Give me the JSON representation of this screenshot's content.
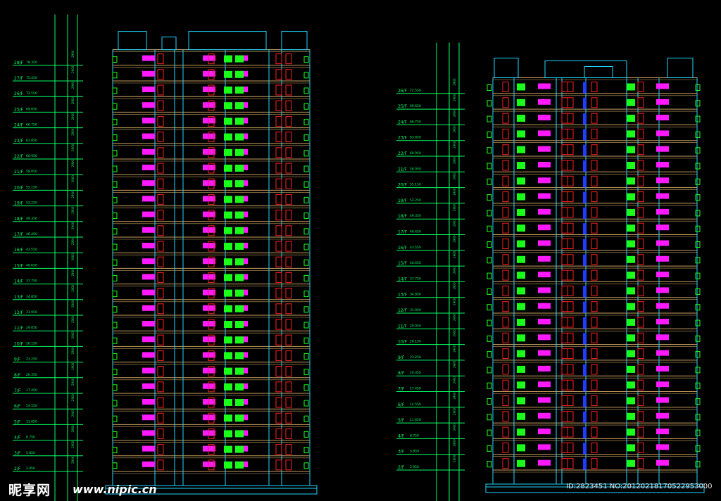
{
  "watermark": {
    "logo": "昵享网",
    "site": "www.nipic.cn",
    "id_line": "ID:2823451 NO:20120218170522953000"
  },
  "colors": {
    "background": "#000000",
    "dimension_line": "#00ff66",
    "outline": "#1fd6ff",
    "floor_band": "#c8a060",
    "window_red": "#ff2020",
    "balcony_magenta": "#ff19ff",
    "balcony_green": "#19ff19",
    "stair_blue": "#1f3cff"
  },
  "elevations": [
    {
      "name": "left",
      "floor_labels": [
        "2/F",
        "3/F",
        "4/F",
        "5/F",
        "6/F",
        "7/F",
        "8/F",
        "9/F",
        "10/F",
        "11/F",
        "12/F",
        "13/F",
        "14/F",
        "15/F",
        "16/F",
        "17/F",
        "18/F",
        "19/F",
        "20/F",
        "21/F",
        "22/F",
        "23/F",
        "24/F",
        "25/F",
        "26/F",
        "27/F",
        "28/F"
      ],
      "level_values": [
        "2.950",
        "5.850",
        "8.750",
        "11.650",
        "14.550",
        "17.450",
        "20.350",
        "23.250",
        "26.150",
        "29.050",
        "31.950",
        "34.850",
        "37.750",
        "40.650",
        "43.550",
        "46.450",
        "49.350",
        "52.250",
        "55.150",
        "58.050",
        "60.950",
        "63.850",
        "66.750",
        "69.650",
        "72.550",
        "75.450",
        "78.350"
      ],
      "storey_height": "2900"
    },
    {
      "name": "right",
      "floor_labels": [
        "2/F",
        "3/F",
        "4/F",
        "5/F",
        "6/F",
        "7/F",
        "8/F",
        "9/F",
        "10/F",
        "11/F",
        "12/F",
        "13/F",
        "14/F",
        "15/F",
        "16/F",
        "17/F",
        "18/F",
        "19/F",
        "20/F",
        "21/F",
        "22/F",
        "23/F",
        "24/F",
        "25/F",
        "26/F"
      ],
      "level_values": [
        "2.950",
        "5.850",
        "8.750",
        "11.650",
        "14.550",
        "17.450",
        "20.350",
        "23.250",
        "26.150",
        "29.050",
        "31.950",
        "34.850",
        "37.750",
        "40.650",
        "43.550",
        "46.450",
        "49.350",
        "52.250",
        "55.150",
        "58.050",
        "60.950",
        "63.850",
        "66.750",
        "69.650",
        "72.550"
      ],
      "storey_height": "2900"
    }
  ]
}
